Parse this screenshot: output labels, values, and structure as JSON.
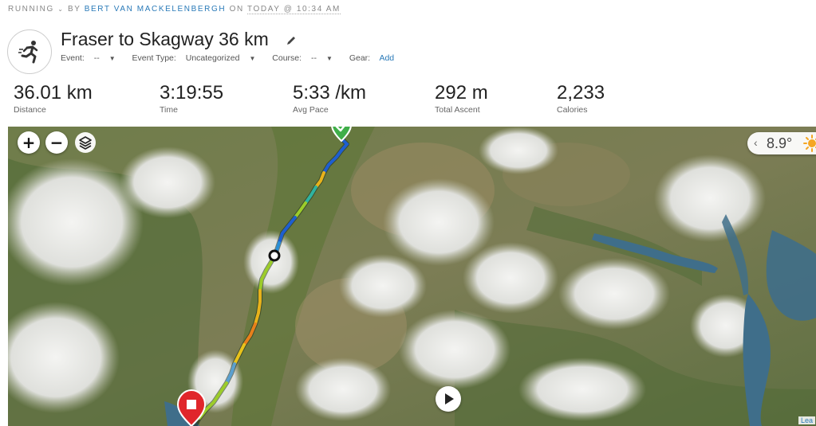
{
  "breadcrumb": {
    "activity_type": "RUNNING",
    "by": "BY",
    "athlete": "BERT VAN MACKELENBERGH",
    "on": "ON",
    "time": "TODAY @ 10:34 AM"
  },
  "activity": {
    "title": "Fraser to Skagway 36 km",
    "icon": "running-icon"
  },
  "meta": {
    "event_label": "Event:",
    "event_value": "--",
    "event_type_label": "Event Type:",
    "event_type_value": "Uncategorized",
    "course_label": "Course:",
    "course_value": "--",
    "gear_label": "Gear:",
    "gear_add": "Add"
  },
  "stats": [
    {
      "value": "36.01 km",
      "label": "Distance"
    },
    {
      "value": "3:19:55",
      "label": "Time"
    },
    {
      "value": "5:33 /km",
      "label": "Avg Pace"
    },
    {
      "value": "292 m",
      "label": "Total Ascent"
    },
    {
      "value": "2,233",
      "label": "Calories"
    }
  ],
  "map": {
    "zoom_in": "+",
    "zoom_out": "−",
    "layers_icon": "layers-icon",
    "weather_temp": "8.9°",
    "weather_icon": "sun-icon",
    "attribution": "Lea",
    "start_marker_color": "#3fae49",
    "end_marker_color": "#e0262b"
  },
  "colors": {
    "link": "#2a7ab8",
    "route_fast": "#1e5fd0",
    "route_mid": "#9ccc2a",
    "route_slow": "#e8a11b"
  }
}
